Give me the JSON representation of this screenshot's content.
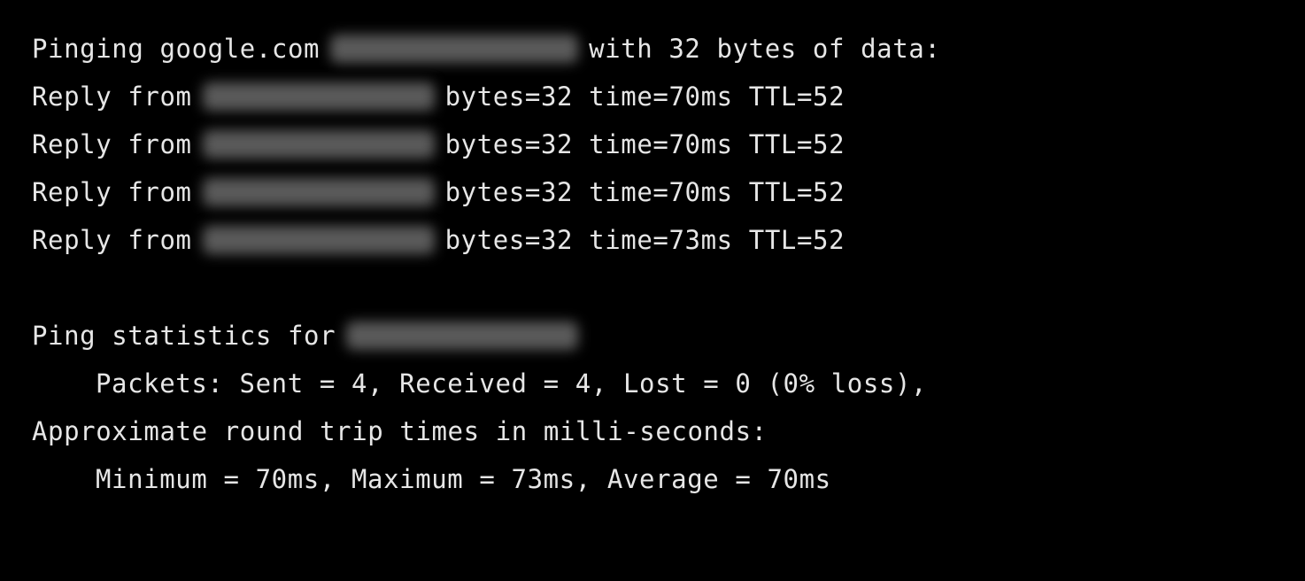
{
  "terminal": {
    "ping_header": {
      "prefix": "Pinging google.com",
      "redacted_ip": "[blurred IP]",
      "suffix": "with 32 bytes of data:"
    },
    "replies": [
      {
        "prefix": "Reply from",
        "redacted_ip": "[blurred IP]",
        "bytes": "bytes=32",
        "time": "time=70ms",
        "ttl": "TTL=52"
      },
      {
        "prefix": "Reply from",
        "redacted_ip": "[blurred IP]",
        "bytes": "bytes=32",
        "time": "time=70ms",
        "ttl": "TTL=52"
      },
      {
        "prefix": "Reply from",
        "redacted_ip": "[blurred IP]",
        "bytes": "bytes=32",
        "time": "time=70ms",
        "ttl": "TTL=52"
      },
      {
        "prefix": "Reply from",
        "redacted_ip": "[blurred IP]",
        "bytes": "bytes=32",
        "time": "time=73ms",
        "ttl": "TTL=52"
      }
    ],
    "stats_header": {
      "prefix": "Ping statistics for",
      "redacted_ip": "[blurred IP]"
    },
    "packets_line": "Packets: Sent = 4, Received = 4, Lost = 0 (0% loss),",
    "rtt_header": "Approximate round trip times in milli-seconds:",
    "rtt_line": "Minimum = 70ms, Maximum = 73ms, Average = 70ms"
  },
  "colors": {
    "background": "#000000",
    "text": "#e6e6e6"
  }
}
